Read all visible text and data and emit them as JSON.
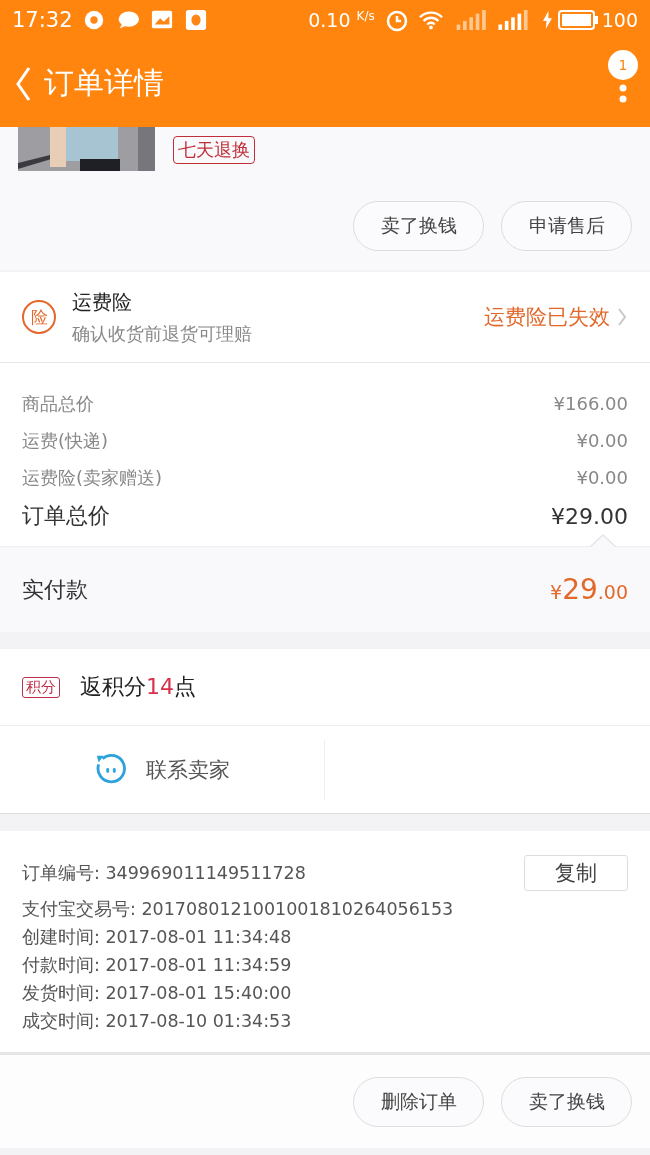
{
  "status_bar": {
    "time": "17:32",
    "speed": "0.10",
    "speed_unit": "K/s",
    "battery": "100"
  },
  "header": {
    "title": "订单详情",
    "badge": "1"
  },
  "product": {
    "tag": "七天退换",
    "buttons": [
      "卖了换钱",
      "申请售后"
    ]
  },
  "insurance": {
    "badge": "险",
    "title": "运费险",
    "subtitle": "确认收货前退货可理赔",
    "status": "运费险已失效"
  },
  "prices": [
    {
      "label": "商品总价",
      "value": "¥166.00",
      "kind": "minor"
    },
    {
      "label": "运费(快递)",
      "value": "¥0.00",
      "kind": "minor"
    },
    {
      "label": "运费险(卖家赠送)",
      "value": "¥0.00",
      "kind": "minor"
    },
    {
      "label": "订单总价",
      "value": "¥29.00",
      "kind": "total"
    }
  ],
  "paid": {
    "label": "实付款",
    "symbol": "¥",
    "integer": "29",
    "decimal": ".00"
  },
  "points": {
    "tag": "积分",
    "prefix": "返积分",
    "number": "14",
    "suffix": "点"
  },
  "contact": {
    "label": "联系卖家"
  },
  "order_info": {
    "copy_button": "复制",
    "rows": [
      {
        "label": "订单编号:",
        "value": "349969011149511728"
      },
      {
        "label": "支付宝交易号:",
        "value": "2017080121001001810264056153"
      },
      {
        "label": "创建时间:",
        "value": "2017-08-01 11:34:48"
      },
      {
        "label": "付款时间:",
        "value": "2017-08-01 11:34:59"
      },
      {
        "label": "发货时间:",
        "value": "2017-08-01 15:40:00"
      },
      {
        "label": "成交时间:",
        "value": "2017-08-10 01:34:53"
      }
    ]
  },
  "footer_buttons": [
    "删除订单",
    "卖了换钱"
  ]
}
